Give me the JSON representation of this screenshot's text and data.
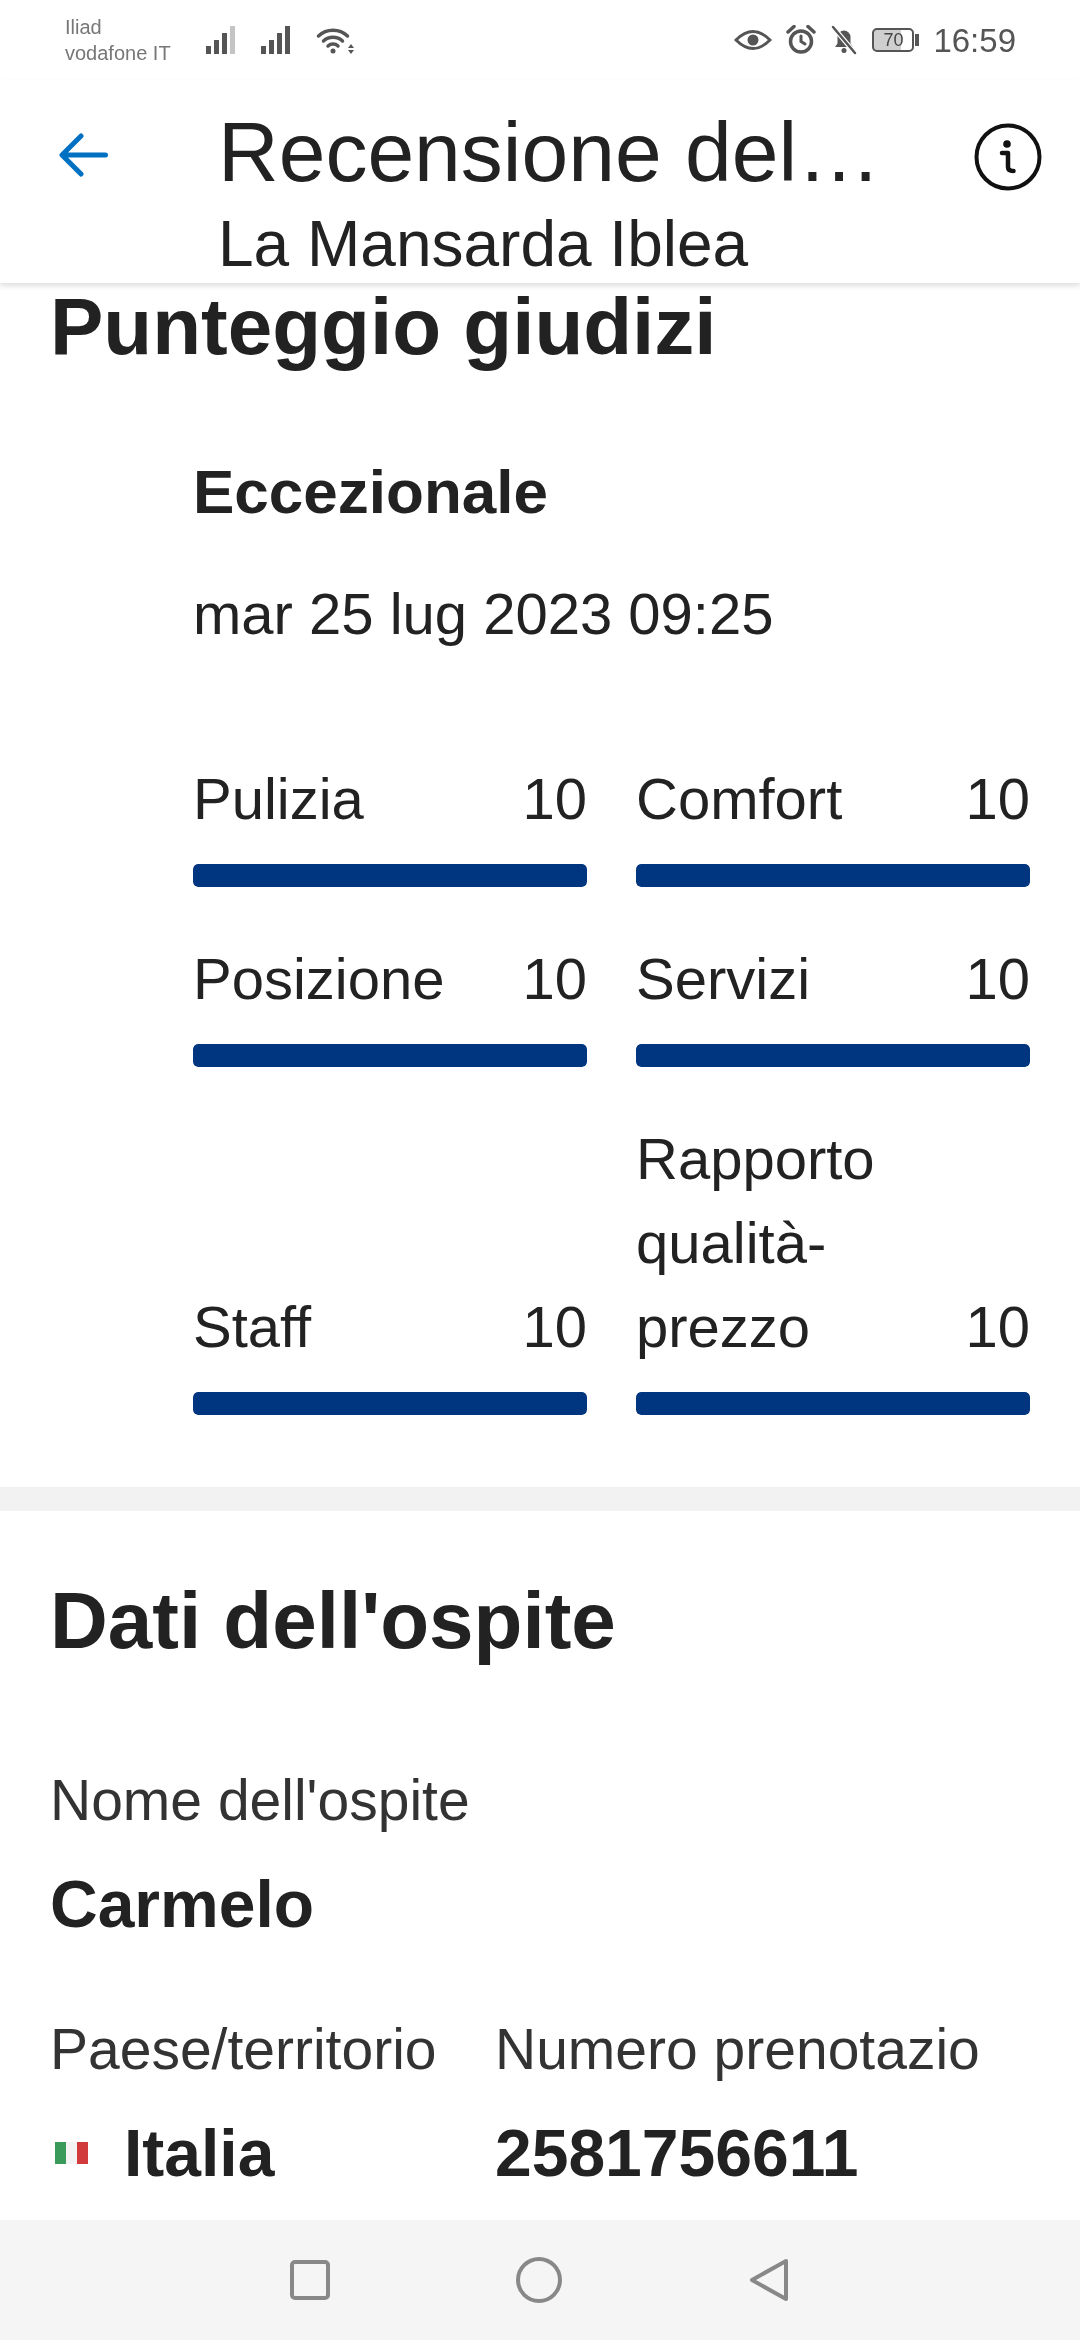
{
  "status_bar": {
    "carriers": [
      "Iliad",
      "vodafone IT"
    ],
    "battery": "70",
    "time": "16:59"
  },
  "header": {
    "title": "Recensione del…",
    "subtitle": "La Mansarda Iblea"
  },
  "score_section": {
    "title": "Punteggio giudizi",
    "rating": "Eccezionale",
    "date": "mar 25 lug 2023 09:25",
    "categories": [
      {
        "label": "Pulizia",
        "score": "10",
        "level": 1
      },
      {
        "label": "Posizione",
        "score": "10",
        "level": 1
      },
      {
        "label": "Staff",
        "score": "10",
        "level": 1
      },
      {
        "label": "Comfort",
        "score": "10",
        "level": 1
      },
      {
        "label": "Servizi",
        "score": "10",
        "level": 1
      },
      {
        "label": "Rapporto qualità-prezzo",
        "score": "10",
        "level": 1
      }
    ]
  },
  "guest_section": {
    "title": "Dati dell'ospite",
    "rows": [
      [
        {
          "kind": "text",
          "label": "Nome dell'ospite",
          "value": "Carmelo"
        }
      ],
      [
        {
          "kind": "country",
          "label": "Paese/territorio",
          "value": "Italia"
        },
        {
          "kind": "text",
          "label": "Numero prenotazio",
          "value": "2581756611"
        }
      ]
    ]
  }
}
